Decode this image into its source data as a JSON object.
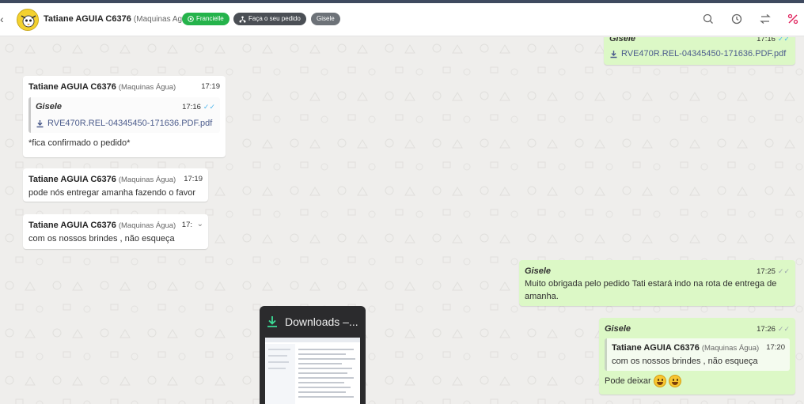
{
  "header": {
    "contact_name": "Tatiane AGUIA C6376",
    "contact_sub": "(Maquinas Agua)",
    "tags": [
      "Francielle",
      "Faça o seu pedido",
      "Gisele"
    ]
  },
  "messages": {
    "top_file": {
      "sender": "Gisele",
      "time": "17:16",
      "file": "RVE470R.REL-04345450-171636.PDF.pdf"
    },
    "m1": {
      "sender": "Tatiane AGUIA C6376",
      "sub": "(Maquinas Água)",
      "time": "17:19",
      "quote_sender": "Gisele",
      "quote_time": "17:16",
      "quote_file": "RVE470R.REL-04345450-171636.PDF.pdf",
      "text": "*fica confirmado o pedido*"
    },
    "m2": {
      "sender": "Tatiane AGUIA C6376",
      "sub": "(Maquinas Água)",
      "time": "17:19",
      "text": "pode nós entregar amanha fazendo o favor"
    },
    "m3": {
      "sender": "Tatiane AGUIA C6376",
      "sub": "(Maquinas Água)",
      "time": "17:",
      "text": "com os nossos brindes , não esqueça"
    },
    "m4": {
      "sender": "Gisele",
      "time": "17:25",
      "text": "Muito obrigada pelo pedido Tati estará indo na rota de entrega de amanha."
    },
    "m5": {
      "sender": "Gisele",
      "time": "17:26",
      "quote_sender": "Tatiane AGUIA C6376",
      "quote_sub": "(Maquinas Água)",
      "quote_time": "17:20",
      "quote_text": "com os nossos brindes , não esqueça",
      "text": "Pode deixar"
    }
  },
  "downloads": {
    "title": "Downloads –..."
  },
  "colors": {
    "incoming": "#ffffff",
    "outgoing": "#dcf8c6",
    "accent_green": "#25b34b",
    "link": "#4c5c8c"
  }
}
